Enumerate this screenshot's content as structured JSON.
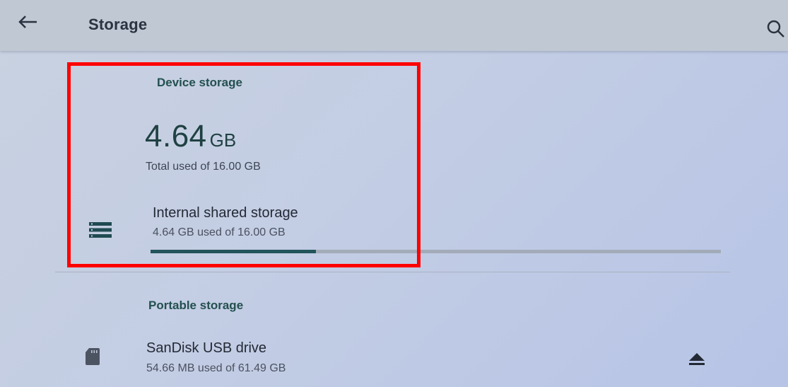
{
  "appbar": {
    "title": "Storage",
    "back_icon": "arrow-left-icon",
    "search_icon": "search-icon"
  },
  "device_storage": {
    "header": "Device storage",
    "used_value": "4.64",
    "used_unit": "GB",
    "total_used_text": "Total used of 16.00 GB",
    "internal": {
      "title": "Internal shared storage",
      "subtitle": "4.64 GB used of 16.00 GB",
      "icon": "storage-icon",
      "used_fraction": 0.29
    }
  },
  "portable_storage": {
    "header": "Portable storage",
    "items": [
      {
        "title": "SanDisk USB drive",
        "subtitle": "54.66 MB used of 61.49 GB",
        "icon": "sd-card-icon",
        "action_icon": "eject-icon"
      }
    ]
  },
  "colors": {
    "accent": "#21555b",
    "highlight": "#ff0000",
    "appbar": "#c0c8d4"
  }
}
